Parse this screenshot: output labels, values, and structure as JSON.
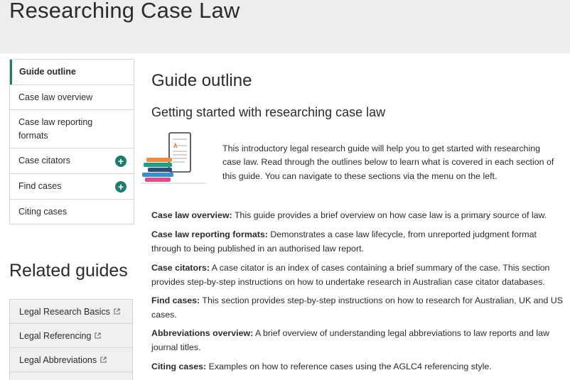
{
  "page": {
    "title": "Researching Case Law"
  },
  "sidebar": {
    "items": [
      {
        "label": "Guide outline"
      },
      {
        "label": "Case law overview"
      },
      {
        "label": "Case law reporting formats"
      },
      {
        "label": "Case citators",
        "expand": "+"
      },
      {
        "label": "Find cases",
        "expand": "+"
      },
      {
        "label": "Citing cases"
      }
    ],
    "accent_color": "#1e7d6b"
  },
  "related": {
    "title": "Related guides",
    "items": [
      {
        "label": "Legal Research Basics"
      },
      {
        "label": "Legal Referencing"
      },
      {
        "label": "Legal Abbreviations"
      }
    ]
  },
  "main": {
    "heading": "Guide outline",
    "subheading": "Getting started with researching case law",
    "illustration_icon": "tablet-and-books-icon",
    "intro": "This introductory legal research guide will help you to get started with researching case law. Read through the outlines below to learn what is covered in each section of this guide. You can navigate to these sections via the menu on the left.",
    "sections": [
      {
        "term": "Case law overview:",
        "text": " This guide provides a brief overview on how case law is a primary source of law."
      },
      {
        "term": "Case law reporting formats:",
        "text": " Demonstrates a case law lifecycle, from unreported judgment format through to being published in an authorised law report."
      },
      {
        "term": "Case citators:",
        "text": " A case citator is an index of cases containing a brief summary of the case. This section provides step-by-step instructions on how to undertake research in Australian case citator databases."
      },
      {
        "term": "Find cases:",
        "text": " This section provides step-by-step instructions on how to research for Australian, UK and US cases."
      },
      {
        "term": "Abbreviations overview:",
        "text": " A brief overview of understanding legal abbreviations to law reports and law journal titles."
      },
      {
        "term": "Citing cases:",
        "text": " Examples on how to reference cases using the AGLC4 referencing style."
      }
    ]
  }
}
